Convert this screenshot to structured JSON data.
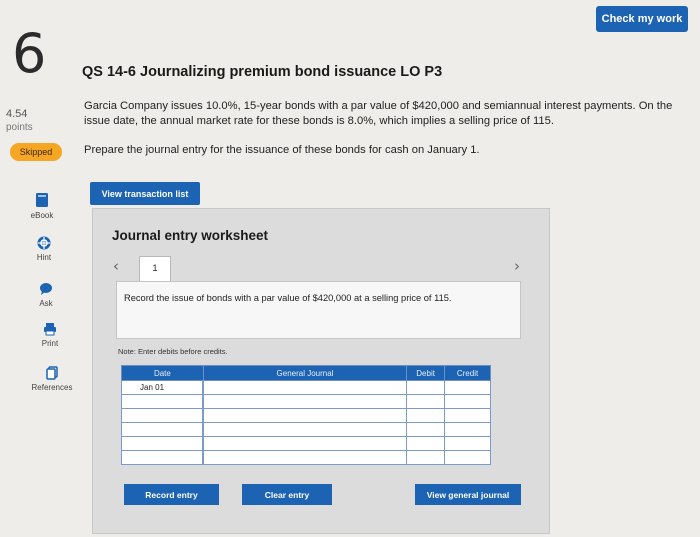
{
  "header": {
    "check_label": "Check my work",
    "question_number": "6",
    "question_title": "QS 14-6 Journalizing premium bond issuance LO P3"
  },
  "left_rail": {
    "points_value": "4.54",
    "points_label": "points",
    "status_badge": "Skipped",
    "tools": [
      {
        "label": "eBook",
        "icon": "book-icon"
      },
      {
        "label": "Hint",
        "icon": "hint-icon"
      },
      {
        "label": "Ask",
        "icon": "speech-bubble-icon"
      },
      {
        "label": "Print",
        "icon": "printer-icon"
      },
      {
        "label": "References",
        "icon": "copy-icon"
      }
    ]
  },
  "problem": {
    "text": "Garcia Company issues 10.0%, 15-year bonds with a par value of $420,000 and semiannual interest payments. On the issue date, the annual market rate for these bonds is 8.0%, which implies a selling price of 115.",
    "instruction": "Prepare the journal entry for the issuance of these bonds for cash on January 1."
  },
  "view_transaction_label": "View transaction list",
  "worksheet": {
    "title": "Journal entry worksheet",
    "tab_label": "1",
    "record_instruction": "Record the issue of bonds with a par value of $420,000 at a selling price of 115.",
    "note": "Note: Enter debits before credits.",
    "columns": [
      "Date",
      "General Journal",
      "Debit",
      "Credit"
    ],
    "rows": [
      {
        "date": "Jan 01",
        "account": "",
        "debit": "",
        "credit": ""
      },
      {
        "date": "",
        "account": "",
        "debit": "",
        "credit": ""
      },
      {
        "date": "",
        "account": "",
        "debit": "",
        "credit": ""
      },
      {
        "date": "",
        "account": "",
        "debit": "",
        "credit": ""
      },
      {
        "date": "",
        "account": "",
        "debit": "",
        "credit": ""
      },
      {
        "date": "",
        "account": "",
        "debit": "",
        "credit": ""
      }
    ],
    "buttons": {
      "record": "Record entry",
      "clear": "Clear entry",
      "view_general_journal": "View general journal"
    }
  },
  "colors": {
    "accent": "#1d63b3",
    "badge": "#f6a623",
    "background": "#eeedea"
  }
}
